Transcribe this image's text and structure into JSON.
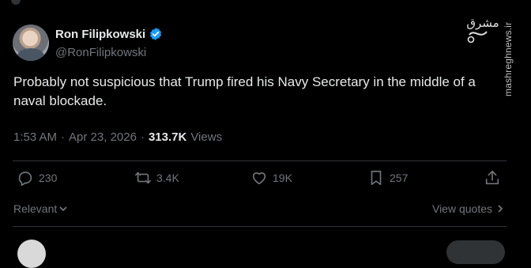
{
  "author": {
    "name": "Ron Filipkowski",
    "handle": "@RonFilipkowski",
    "verified_color": "#1d9bf0"
  },
  "tweet": {
    "text": "Probably not suspicious that Trump fired his Navy Secretary in the middle of a naval blockade.",
    "time": "1:53 AM",
    "separator": "·",
    "date": "Apr 23, 2026",
    "separator2": "·",
    "views_count": "313.7K",
    "views_label": "Views"
  },
  "actions": {
    "replies": "230",
    "reposts": "3.4K",
    "likes": "19K",
    "bookmarks": "257"
  },
  "footer": {
    "sort_label": "Relevant",
    "view_quotes_label": "View quotes"
  },
  "watermark": {
    "logo_text": "مشرق",
    "site": "mashreghnews.ir"
  },
  "colors": {
    "background": "#000000",
    "text_primary": "#e7e9ea",
    "text_secondary": "#71767b",
    "divider": "#2f3336"
  }
}
